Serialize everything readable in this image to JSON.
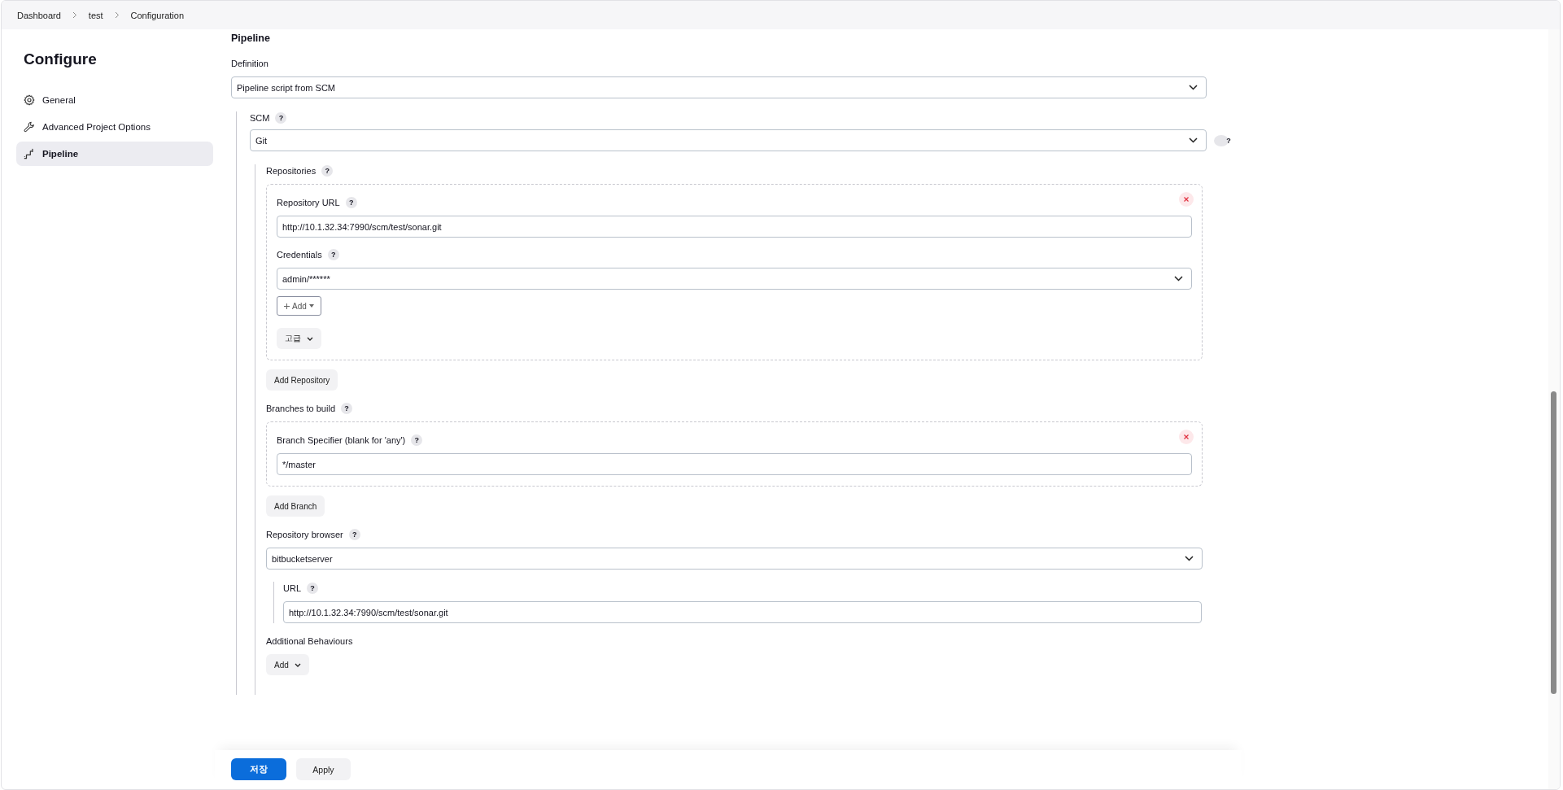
{
  "breadcrumbs": [
    "Dashboard",
    "test",
    "Configuration"
  ],
  "sidebar": {
    "title": "Configure",
    "items": [
      {
        "label": "General",
        "kind": "gear",
        "selected": false
      },
      {
        "label": "Advanced Project Options",
        "kind": "wrench",
        "selected": false
      },
      {
        "label": "Pipeline",
        "kind": "pipeline",
        "selected": true
      }
    ]
  },
  "pipeline": {
    "title": "Pipeline",
    "definition": {
      "label": "Definition",
      "value": "Pipeline script from SCM"
    },
    "scm": {
      "label": "SCM",
      "help": "?",
      "value": "Git",
      "side_help": "?",
      "repositories": {
        "label": "Repositories",
        "help": "?",
        "items": [
          {
            "url_label": "Repository URL",
            "url_help": "?",
            "url": "http://10.1.32.34:7990/scm/test/sonar.git",
            "credentials_label": "Credentials",
            "credentials_help": "?",
            "credentials": "admin/******",
            "add_button": "Add",
            "advanced_button": "고급"
          }
        ],
        "add_button": "Add Repository"
      },
      "branches": {
        "label": "Branches to build",
        "help": "?",
        "items": [
          {
            "label": "Branch Specifier (blank for 'any')",
            "help": "?",
            "value": "*/master"
          }
        ],
        "add_button": "Add Branch"
      },
      "browser": {
        "label": "Repository browser",
        "help": "?",
        "value": "bitbucketserver",
        "url_label": "URL",
        "url_help": "?",
        "url": "http://10.1.32.34:7990/scm/test/sonar.git"
      },
      "behaviours": {
        "label": "Additional Behaviours",
        "add_button": "Add"
      }
    }
  },
  "footer": {
    "save": "저장",
    "apply": "Apply"
  }
}
